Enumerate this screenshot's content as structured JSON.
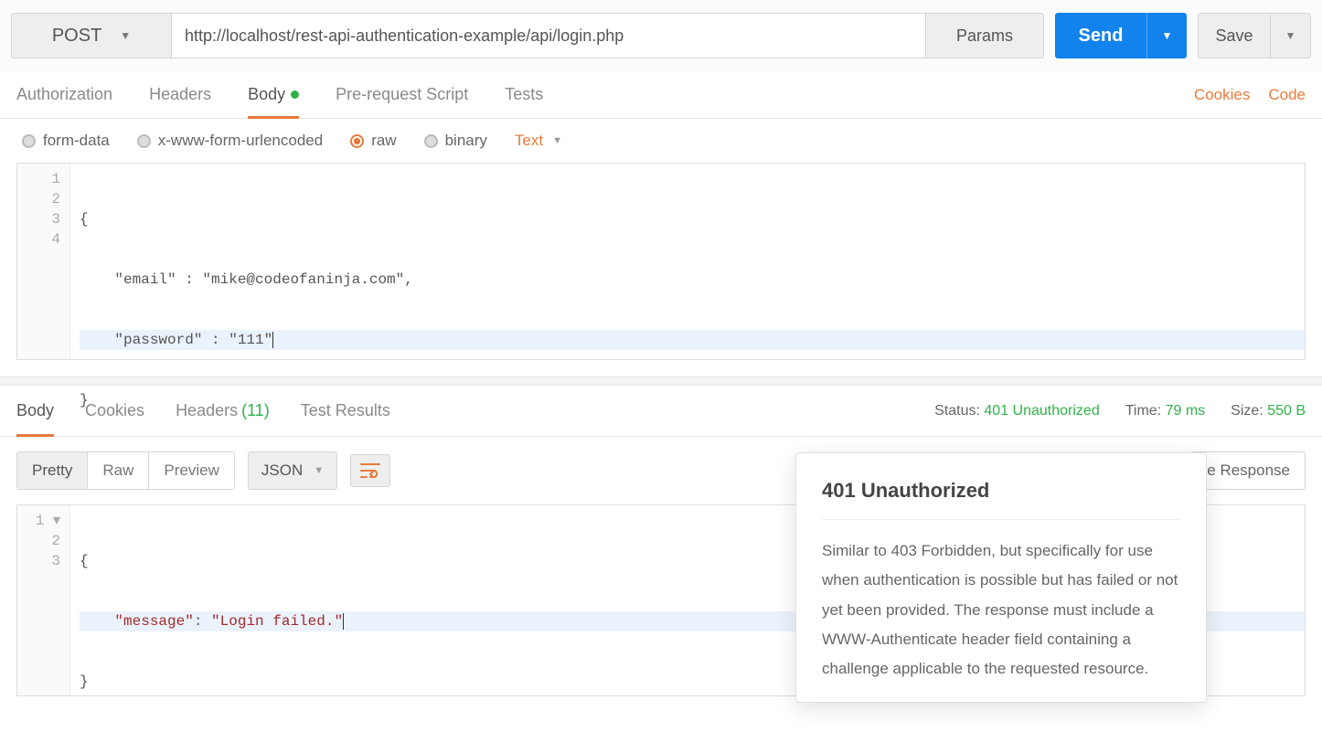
{
  "request": {
    "method": "POST",
    "url": "http://localhost/rest-api-authentication-example/api/login.php",
    "params_btn": "Params",
    "send_btn": "Send",
    "save_btn": "Save"
  },
  "req_tabs": {
    "authorization": "Authorization",
    "headers": "Headers",
    "body": "Body",
    "prerequest": "Pre-request Script",
    "tests": "Tests"
  },
  "links": {
    "cookies": "Cookies",
    "code": "Code"
  },
  "body_types": {
    "formdata": "form-data",
    "urlencoded": "x-www-form-urlencoded",
    "raw": "raw",
    "binary": "binary",
    "lang": "Text"
  },
  "request_body": {
    "l1": "{",
    "l2": "    \"email\" : \"mike@codeofaninja.com\",",
    "l3": "    \"password\" : \"111\"",
    "l4": "}"
  },
  "resp_tabs": {
    "body": "Body",
    "cookies": "Cookies",
    "headers": "Headers",
    "headers_count": "(11)",
    "tests": "Test Results"
  },
  "resp_meta": {
    "status_lbl": "Status:",
    "status_val": "401 Unauthorized",
    "time_lbl": "Time:",
    "time_val": "79 ms",
    "size_lbl": "Size:",
    "size_val": "550 B"
  },
  "resp_controls": {
    "pretty": "Pretty",
    "raw": "Raw",
    "preview": "Preview",
    "format": "JSON",
    "save_response": "e Response"
  },
  "response_body": {
    "l1": "{",
    "l2_a": "    \"message\"",
    "l2_b": ": ",
    "l2_c": "\"Login failed.\"",
    "l3": "}"
  },
  "tooltip": {
    "title": "401 Unauthorized",
    "text": "Similar to 403 Forbidden, but specifically for use when authentication is possible but has failed or not yet been provided. The response must include a WWW-Authenticate header field containing a challenge applicable to the requested resource."
  }
}
